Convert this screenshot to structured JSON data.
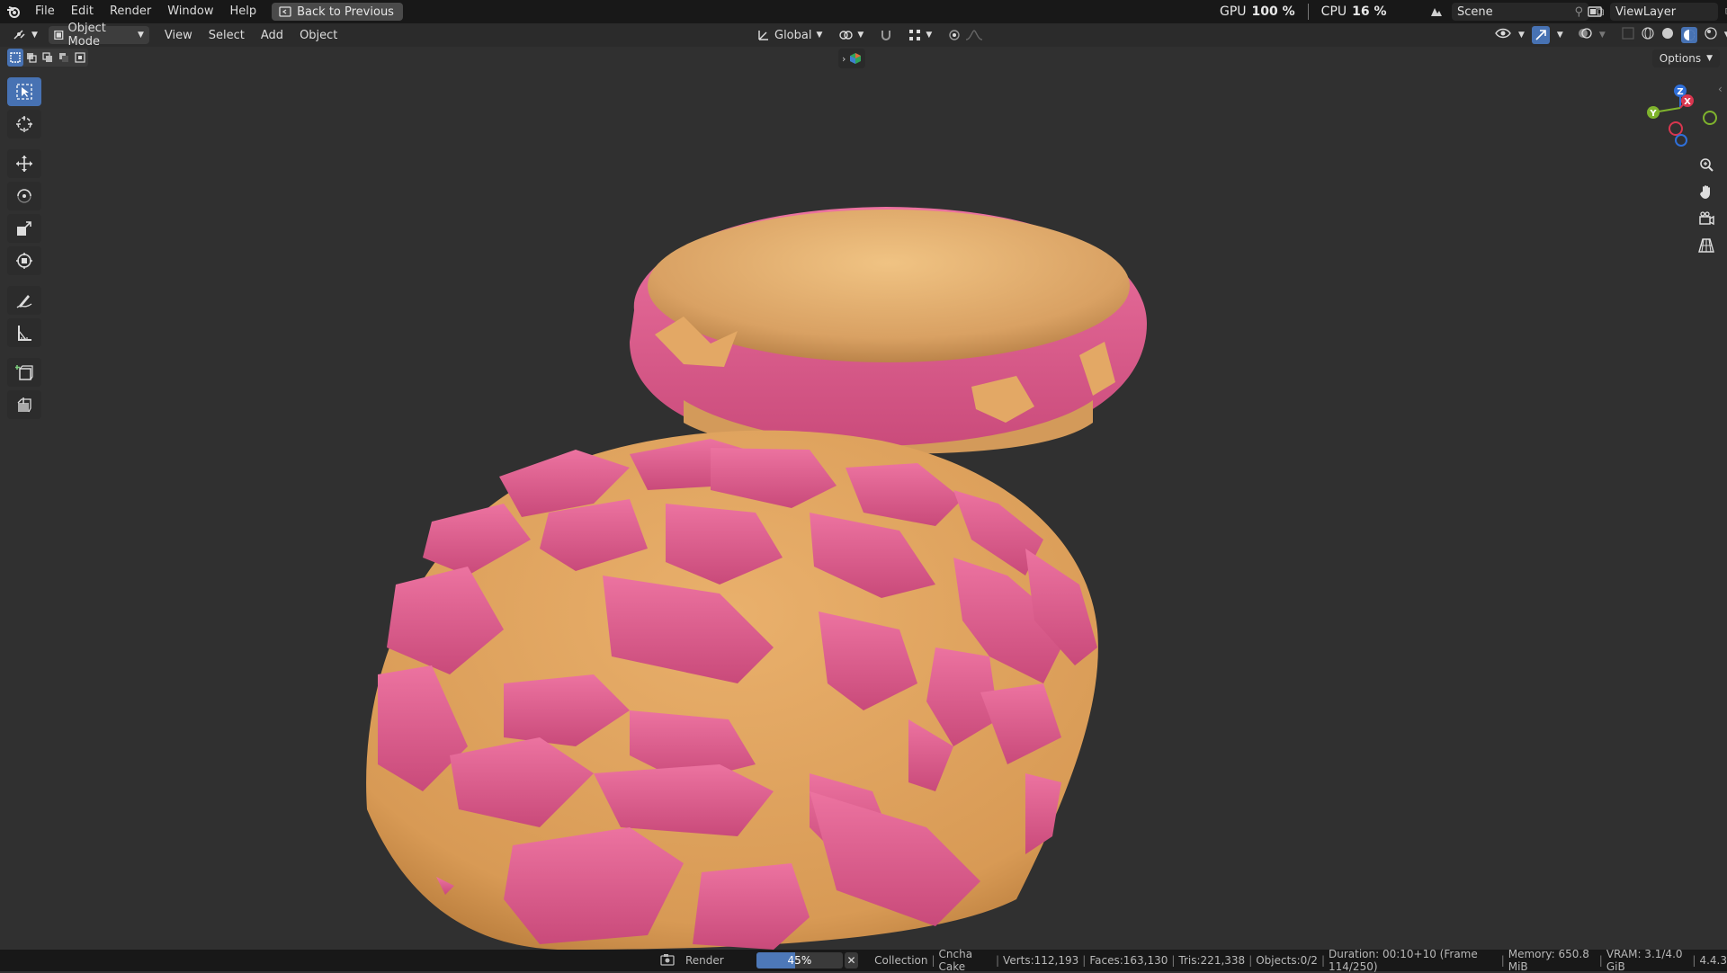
{
  "topbar": {
    "menus": [
      "File",
      "Edit",
      "Render",
      "Window",
      "Help"
    ],
    "back_label": "Back to Previous",
    "gpu_label": "GPU",
    "gpu_value": "100 %",
    "cpu_label": "CPU",
    "cpu_value": "16 %",
    "scene_name": "Scene",
    "view_layer": "ViewLayer"
  },
  "header": {
    "mode": "Object Mode",
    "menus": [
      "View",
      "Select",
      "Add",
      "Object"
    ],
    "orientation": "Global",
    "options_label": "Options"
  },
  "toolbar": {
    "tools": [
      "select-box",
      "cursor",
      "move",
      "rotate",
      "scale",
      "transform",
      "annotate",
      "measure",
      "add-cube",
      "extrude"
    ],
    "active_tool": "select-box"
  },
  "gizmo": {
    "x": "X",
    "y": "Y",
    "z": "Z"
  },
  "status": {
    "job_label": "Render",
    "progress": "45%",
    "progress_fraction": 0.45,
    "collection": "Collection",
    "object": "Cncha Cake",
    "verts": "Verts:112,193",
    "faces": "Faces:163,130",
    "tris": "Tris:221,338",
    "objects": "Objects:0/2",
    "duration": "Duration: 00:10+10 (Frame 114/250)",
    "memory": "Memory: 650.8 MiB",
    "vram": "VRAM: 3.1/4.0 GiB",
    "version": "4.4.3"
  },
  "colors": {
    "accent": "#4772b3",
    "bread": "#e2a965",
    "topping": "#e0608f",
    "viewport_bg": "#303030"
  }
}
